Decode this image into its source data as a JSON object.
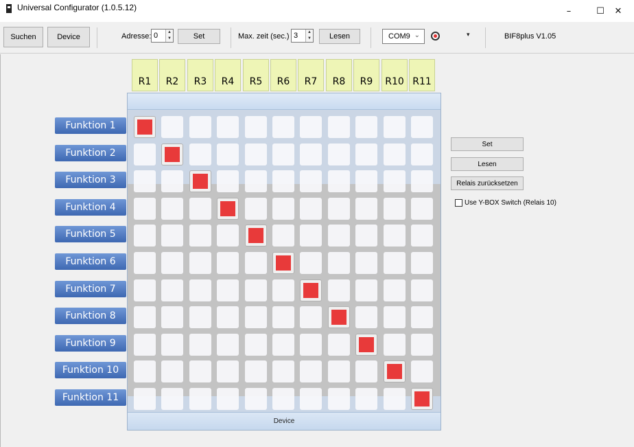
{
  "window": {
    "title": "Universal Configurator (1.0.5.12)",
    "minimize": "–",
    "maximize": "☐",
    "close": "✕"
  },
  "toolbar": {
    "search_label": "Suchen",
    "device_label": "Device",
    "address_label": "Adresse:",
    "address_value": "0",
    "set_label": "Set",
    "max_time_label": "Max. zeit (sec.)",
    "max_time_value": "3",
    "read_label": "Lesen",
    "port_value": "COM9",
    "dropdown_glyph": "▾",
    "version": "BIF8plus V1.05"
  },
  "matrix": {
    "relays": [
      "R1",
      "R2",
      "R3",
      "R4",
      "R5",
      "R6",
      "R7",
      "R8",
      "R9",
      "R10",
      "R11"
    ],
    "functions": [
      "Funktion 1",
      "Funktion 2",
      "Funktion 3",
      "Funktion 4",
      "Funktion 5",
      "Funktion 6",
      "Funktion 7",
      "Funktion 8",
      "Funktion 9",
      "Funktion 10",
      "Funktion 11"
    ],
    "active": [
      [
        0,
        0
      ],
      [
        1,
        1
      ],
      [
        2,
        2
      ],
      [
        3,
        3
      ],
      [
        4,
        4
      ],
      [
        5,
        5
      ],
      [
        6,
        6
      ],
      [
        7,
        7
      ],
      [
        8,
        8
      ],
      [
        9,
        9
      ],
      [
        10,
        10
      ]
    ],
    "footer": "Device",
    "active_color": "#e83a3a"
  },
  "right_panel": {
    "set_label": "Set",
    "read_label": "Lesen",
    "reset_label": "Relais zurücksetzen",
    "checkbox_label": "Use Y-BOX Switch (Relais 10)",
    "checkbox_checked": false
  },
  "icons": [
    "app-icon",
    "spin-arrows-icon",
    "chevron-down-icon",
    "radio-status-icon",
    "dropdown-arrow-icon"
  ]
}
